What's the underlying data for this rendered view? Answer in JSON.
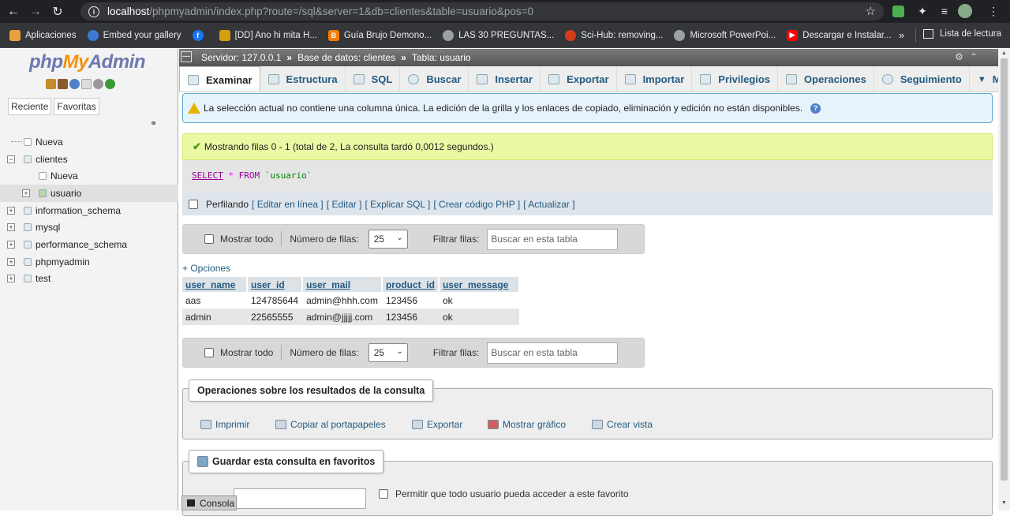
{
  "browser": {
    "url_host": "localhost",
    "url_path": "/phpmyadmin/index.php?route=/sql&server=1&db=clientes&table=usuario&pos=0",
    "bookmarks": [
      {
        "label": "Aplicaciones",
        "icon": "apps-grid-icon",
        "color": "#e8a33d"
      },
      {
        "label": "Embed your gallery",
        "icon": "gallery-icon",
        "color": "#3b7bd4"
      },
      {
        "label": "",
        "icon": "facebook-icon",
        "color": "#1877f2"
      },
      {
        "label": "[DD] Ano hi mita H...",
        "icon": "dd-icon",
        "color": "#d4a010"
      },
      {
        "label": "Guía Brujo Demono...",
        "icon": "blogger-icon",
        "color": "#f57c00"
      },
      {
        "label": "LAS 30 PREGUNTAS...",
        "icon": "globe-icon",
        "color": "#9aa0a6"
      },
      {
        "label": "Sci-Hub: removing...",
        "icon": "scihub-icon",
        "color": "#d43d1a"
      },
      {
        "label": "Microsoft PowerPoi...",
        "icon": "globe-icon",
        "color": "#9aa0a6"
      },
      {
        "label": "Descargar e Instalar...",
        "icon": "youtube-icon",
        "color": "#ff0000"
      }
    ],
    "more": "»",
    "reading_list": "Lista de lectura"
  },
  "left": {
    "logo": {
      "php": "php",
      "my": "My",
      "admin": "Admin"
    },
    "tab_recent": "Reciente",
    "tab_favorites": "Favoritas",
    "tree": [
      {
        "label": "Nueva",
        "level": 0
      },
      {
        "label": "clientes",
        "level": 0
      },
      {
        "label": "Nueva",
        "level": 1
      },
      {
        "label": "usuario",
        "level": 1
      },
      {
        "label": "information_schema",
        "level": 0
      },
      {
        "label": "mysql",
        "level": 0
      },
      {
        "label": "performance_schema",
        "level": 0
      },
      {
        "label": "phpmyadmin",
        "level": 0
      },
      {
        "label": "test",
        "level": 0
      }
    ]
  },
  "breadcrumb": {
    "server": "Servidor: 127.0.0.1",
    "database": "Base de datos: clientes",
    "table": "Tabla: usuario",
    "separator": "»"
  },
  "tabs": [
    "Examinar",
    "Estructura",
    "SQL",
    "Buscar",
    "Insertar",
    "Exportar",
    "Importar",
    "Privilegios",
    "Operaciones",
    "Seguimiento",
    "Ma"
  ],
  "notice_warning": "La selección actual no contiene una columna única. La edición de la grilla y los enlaces de copiado, eliminación y edición no están disponibles.",
  "notice_success": "Mostrando filas 0 - 1 (total de 2, La consulta tardó 0,0012 segundos.)",
  "sql": {
    "select": "SELECT",
    "star": "*",
    "from": "FROM",
    "table": "`usuario`"
  },
  "profiling": {
    "label": "Perfilando",
    "links": [
      "[ Editar en línea ]",
      "[ Editar ]",
      "[ Explicar SQL ]",
      "[ Crear código PHP ]",
      "[ Actualizar ]"
    ]
  },
  "nav": {
    "show_all": "Mostrar todo",
    "rows_label": "Número de filas:",
    "rows_value": "25",
    "filter_label": "Filtrar filas:",
    "filter_placeholder": "Buscar en esta tabla"
  },
  "options_link": "+ Opciones",
  "table": {
    "columns": [
      "user_name",
      "user_id",
      "user_mail",
      "product_id",
      "user_message"
    ],
    "rows": [
      [
        "aas",
        "124785644",
        "admin@hhh.com",
        "123456",
        "ok"
      ],
      [
        "admin",
        "22565555",
        "admin@jjjjj.com",
        "123456",
        "ok"
      ]
    ]
  },
  "query_ops": {
    "legend": "Operaciones sobre los resultados de la consulta",
    "links": [
      "Imprimir",
      "Copiar al portapapeles",
      "Exportar",
      "Mostrar gráfico",
      "Crear vista"
    ]
  },
  "bookmark_query": {
    "legend": "Guardar esta consulta en favoritos",
    "allow_label": "Permitir que todo usuario pueda acceder a este favorito"
  },
  "console_label": "Consola"
}
